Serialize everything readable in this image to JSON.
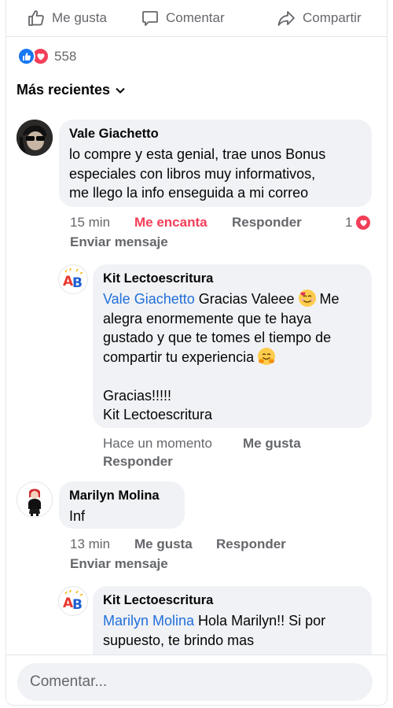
{
  "actions": {
    "like": "Me gusta",
    "comment": "Comentar",
    "share": "Compartir"
  },
  "reactions": {
    "count": "558",
    "icons": [
      "like-icon",
      "love-icon"
    ]
  },
  "sort": {
    "label": "Más recientes"
  },
  "comments": [
    {
      "author": "Vale Giachetto",
      "lines": [
        "lo compre y esta genial, trae unos Bonus",
        "especiales con libros muy informativos,",
        "me llego la info enseguida a mi correo"
      ],
      "time": "15 min",
      "reaction_label": "Me encanta",
      "reply": "Responder",
      "reaction_count": "1",
      "message": "Enviar mensaje"
    },
    {
      "author": "Kit Lectoescritura",
      "mention": "Vale Giachetto",
      "line1_rest": " Gracias Valeee",
      "lines": [
        "alegra enormemente que te haya",
        "gustado y que te tomes el tiempo de",
        "compartir tu experiencia"
      ],
      "line1_end": " Me",
      "thanks": "Gracias!!!!!",
      "signature": "Kit Lectoescritura",
      "time": "Hace un momento",
      "like": "Me gusta",
      "reply": "Responder"
    },
    {
      "author": "Marilyn Molina",
      "text": "Inf",
      "time": "13 min",
      "like": "Me gusta",
      "reply": "Responder",
      "message": "Enviar mensaje"
    },
    {
      "author": "Kit Lectoescritura",
      "mention": "Marilyn Molina",
      "line1_rest": " Hola Marilyn!! Si por",
      "line2": "supuesto, te brindo mas"
    }
  ],
  "composer": {
    "placeholder": "Comentar..."
  },
  "logo": {
    "letters": "AB"
  },
  "colors": {
    "accent": "#1877f2",
    "love": "#f33e58",
    "bubble": "#f0f2f5",
    "meta": "#65676b",
    "mention": "#216fdb"
  }
}
